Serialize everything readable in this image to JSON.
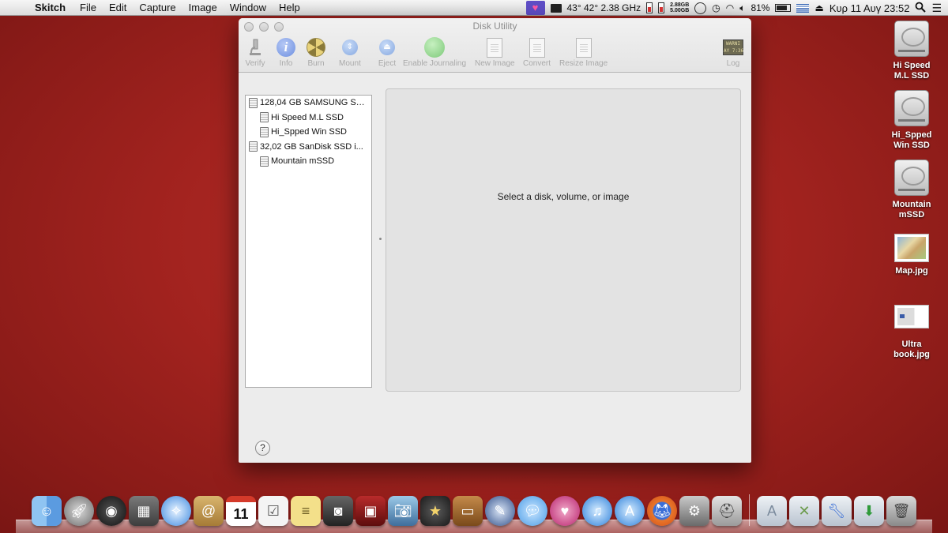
{
  "menubar": {
    "app_name": "Skitch",
    "items": [
      "File",
      "Edit",
      "Capture",
      "Image",
      "Window",
      "Help"
    ],
    "status": {
      "temps": "43° 42° 2.38 GHz",
      "mem_top": "2.88GB",
      "mem_bottom": "5.00GB",
      "battery_percent": "81%",
      "datetime": "Κυρ 11 Αυγ  23:52"
    }
  },
  "window": {
    "title": "Disk Utility",
    "toolbar": {
      "verify": "Verify",
      "info": "Info",
      "burn": "Burn",
      "mount": "Mount",
      "eject": "Eject",
      "journaling": "Enable Journaling",
      "new_image": "New Image",
      "convert": "Convert",
      "resize_image": "Resize Image",
      "log": "Log",
      "log_screen": "WARNI\nAY 7:36"
    },
    "disks": [
      {
        "label": "128,04 GB SAMSUNG SS..."
      },
      {
        "label": "Hi Speed M.L SSD"
      },
      {
        "label": "Hi_Spped Win SSD"
      },
      {
        "label": "32,02 GB SanDisk SSD i..."
      },
      {
        "label": "Mountain mSSD"
      }
    ],
    "placeholder": "Select a disk, volume, or image",
    "help": "?"
  },
  "desktop": {
    "icons": [
      {
        "label": "Hi Speed\nM.L SSD",
        "type": "drive"
      },
      {
        "label": "Hi_Spped\nWin SSD",
        "type": "drive"
      },
      {
        "label": "Mountain\nmSSD",
        "type": "drive"
      },
      {
        "label": "Map.jpg",
        "type": "image"
      },
      {
        "label": "Ultra\nbook.jpg",
        "type": "image"
      }
    ]
  },
  "dock": {
    "calendar_day": "11",
    "apps": [
      "finder-icon",
      "launchpad-icon",
      "dashboard-icon",
      "photo-browser-icon",
      "safari-icon",
      "contacts-icon",
      "calendar-icon",
      "reminders-icon",
      "notes-icon",
      "facetime-icon",
      "photo-booth-icon",
      "iphoto-icon",
      "imovie-icon",
      "keynote-icon",
      "preview-icon",
      "messages-icon",
      "heart-app-icon",
      "itunes-icon",
      "app-store-icon",
      "firefox-icon",
      "system-preferences-icon",
      "disk-utility-icon"
    ],
    "folders": [
      "applications-folder-icon",
      "utilities-folder-icon",
      "tools-folder-icon",
      "downloads-folder-icon",
      "trash-icon"
    ]
  },
  "colors": {
    "desktop_bg": "#a3231f",
    "menubar": "#e6e6e6",
    "window_bg": "#ececec"
  }
}
